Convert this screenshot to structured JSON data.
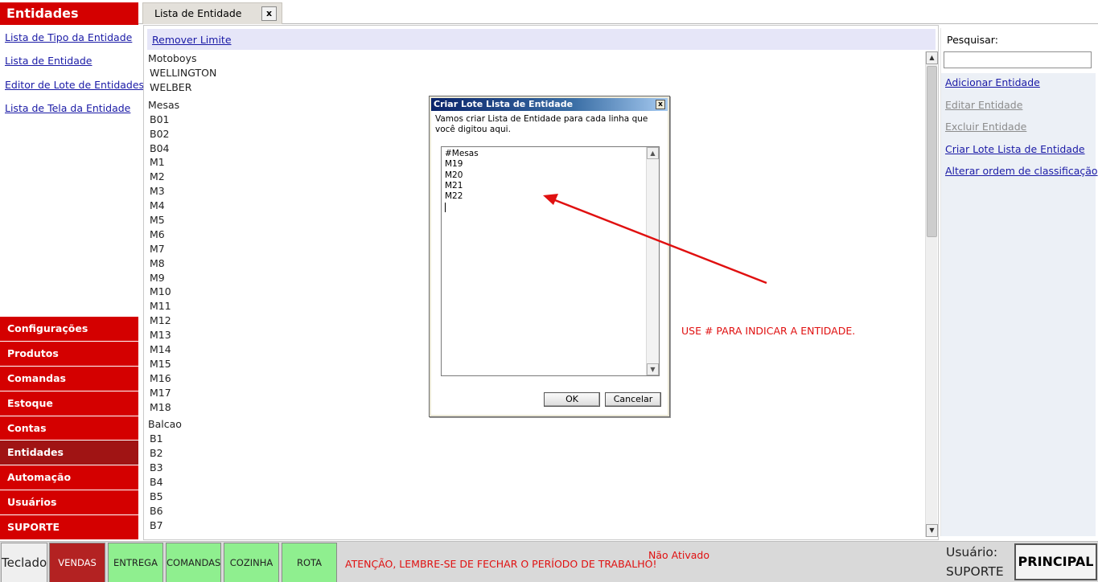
{
  "sidebar": {
    "title": "Entidades",
    "links": [
      "Lista de Tipo da Entidade",
      "Lista de Entidade",
      "Editor de Lote de Entidades",
      "Lista de Tela da Entidade"
    ],
    "nav": [
      "Configurações",
      "Produtos",
      "Comandas",
      "Estoque",
      "Contas",
      "Entidades",
      "Automação",
      "Usuários",
      "SUPORTE"
    ],
    "active_nav": "Entidades"
  },
  "tab": {
    "label": "Lista de Entidade",
    "close": "x"
  },
  "main": {
    "remove_limit": "Remover Limite",
    "groups": [
      {
        "header": "Motoboys",
        "items": [
          "WELLINGTON",
          "WELBER"
        ]
      },
      {
        "header": "Mesas",
        "items": [
          "B01",
          "B02",
          "B04",
          "M1",
          "M2",
          "M3",
          "M4",
          "M5",
          "M6",
          "M7",
          "M8",
          "M9",
          "M10",
          "M11",
          "M12",
          "M13",
          "M14",
          "M15",
          "M16",
          "M17",
          "M18"
        ]
      },
      {
        "header": "Balcao",
        "items": [
          "B1",
          "B2",
          "B3",
          "B4",
          "B5",
          "B6",
          "B7"
        ]
      }
    ]
  },
  "right": {
    "search_label": "Pesquisar:",
    "search_value": "",
    "actions": [
      {
        "label": "Adicionar Entidade",
        "enabled": true
      },
      {
        "label": "Editar Entidade",
        "enabled": false
      },
      {
        "label": "Excluir Entidade",
        "enabled": false
      },
      {
        "label": "Criar Lote Lista de Entidade",
        "enabled": true
      },
      {
        "label": "Alterar ordem de classificação",
        "enabled": true
      }
    ]
  },
  "dialog": {
    "title": "Criar Lote Lista de Entidade",
    "close": "x",
    "message": "Vamos criar Lista de Entidade para cada linha que você digitou aqui.",
    "lines": [
      "#Mesas",
      "M19",
      "M20",
      "M21",
      "M22"
    ],
    "ok": "OK",
    "cancel": "Cancelar"
  },
  "annotation": "USE # PARA INDICAR A ENTIDADE.",
  "bottom": {
    "keyboard": "Teclado",
    "buttons": [
      {
        "label": "VENDAS",
        "style": "red"
      },
      {
        "label": "ENTREGA",
        "style": "green"
      },
      {
        "label": "COMANDAS",
        "style": "green"
      },
      {
        "label": "COZINHA",
        "style": "green"
      },
      {
        "label": "ROTA",
        "style": "green"
      }
    ],
    "warning": "ATENÇÃO, LEMBRE-SE DE FECHAR O PERÍODO DE TRABALHO!",
    "status": "Não Ativado",
    "user_label": "Usuário:",
    "user_name": "SUPORTE",
    "principal": "PRINCIPAL"
  },
  "colors": {
    "accent": "#d40000",
    "active_nav": "#a01414",
    "link": "#1a1aa6",
    "button_green": "#8fef8f",
    "warning": "#e01010"
  }
}
